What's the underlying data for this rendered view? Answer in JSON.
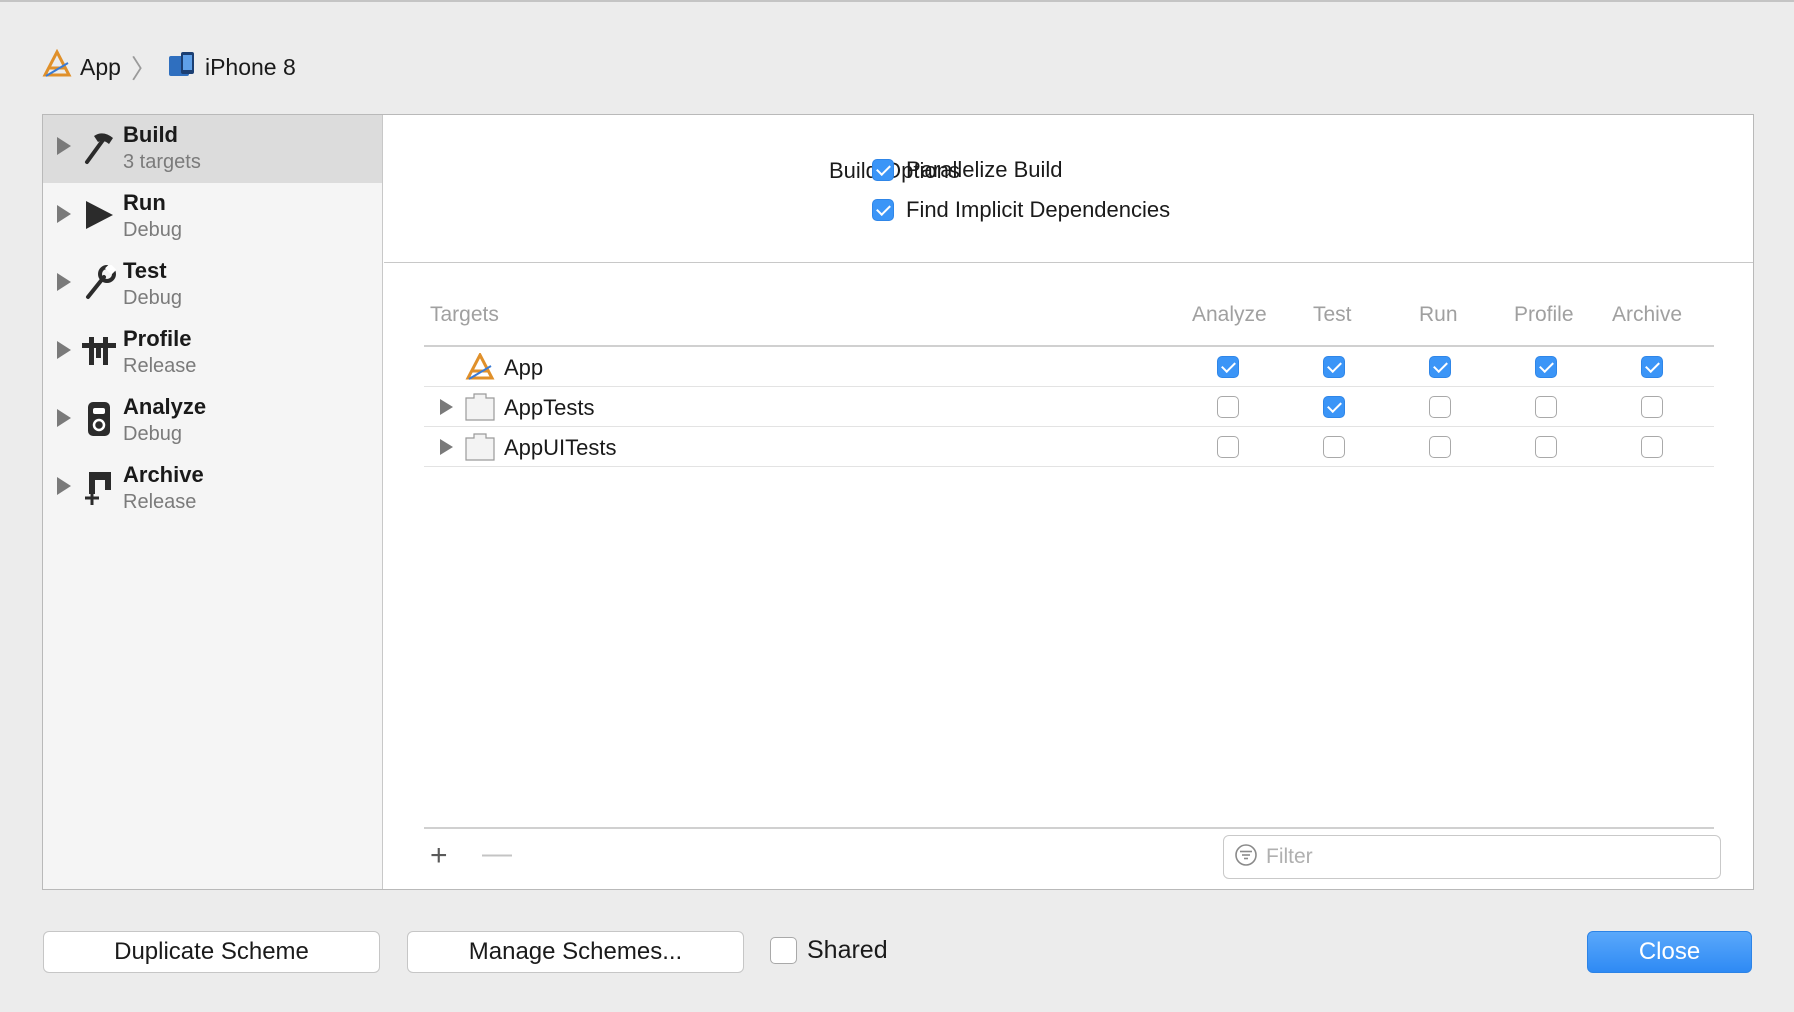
{
  "breadcrumb": [
    {
      "label": "App",
      "icon": "app-icon"
    },
    {
      "label": "iPhone 8",
      "icon": "iphone-icon"
    }
  ],
  "sidebar": {
    "items": [
      {
        "title": "Build",
        "subtitle": "3 targets",
        "icon": "hammer-icon",
        "selected": true
      },
      {
        "title": "Run",
        "subtitle": "Debug",
        "icon": "play-icon"
      },
      {
        "title": "Test",
        "subtitle": "Debug",
        "icon": "wrench-icon"
      },
      {
        "title": "Profile",
        "subtitle": "Release",
        "icon": "instruments-icon"
      },
      {
        "title": "Analyze",
        "subtitle": "Debug",
        "icon": "analyze-icon"
      },
      {
        "title": "Archive",
        "subtitle": "Release",
        "icon": "archive-icon"
      }
    ]
  },
  "build_options": {
    "label": "Build Options",
    "options": [
      {
        "label": "Parallelize Build",
        "checked": true
      },
      {
        "label": "Find Implicit Dependencies",
        "checked": true
      }
    ]
  },
  "targets_table": {
    "headers": [
      "Targets",
      "Analyze",
      "Test",
      "Run",
      "Profile",
      "Archive"
    ],
    "rows": [
      {
        "name": "App",
        "icon": "app-icon",
        "expandable": false,
        "analyze": true,
        "test": true,
        "run": true,
        "profile": true,
        "archive": true
      },
      {
        "name": "AppTests",
        "icon": "bundle-icon",
        "expandable": true,
        "analyze": false,
        "test": true,
        "run": false,
        "profile": false,
        "archive": false
      },
      {
        "name": "AppUITests",
        "icon": "bundle-icon",
        "expandable": true,
        "analyze": false,
        "test": false,
        "run": false,
        "profile": false,
        "archive": false
      }
    ]
  },
  "footer": {
    "add_label": "+",
    "remove_label": "—",
    "filter_placeholder": "Filter"
  },
  "buttons": {
    "duplicate": "Duplicate Scheme",
    "manage": "Manage Schemes...",
    "shared_label": "Shared",
    "shared_checked": false,
    "close": "Close"
  },
  "colors": {
    "accent": "#3b95f7"
  }
}
